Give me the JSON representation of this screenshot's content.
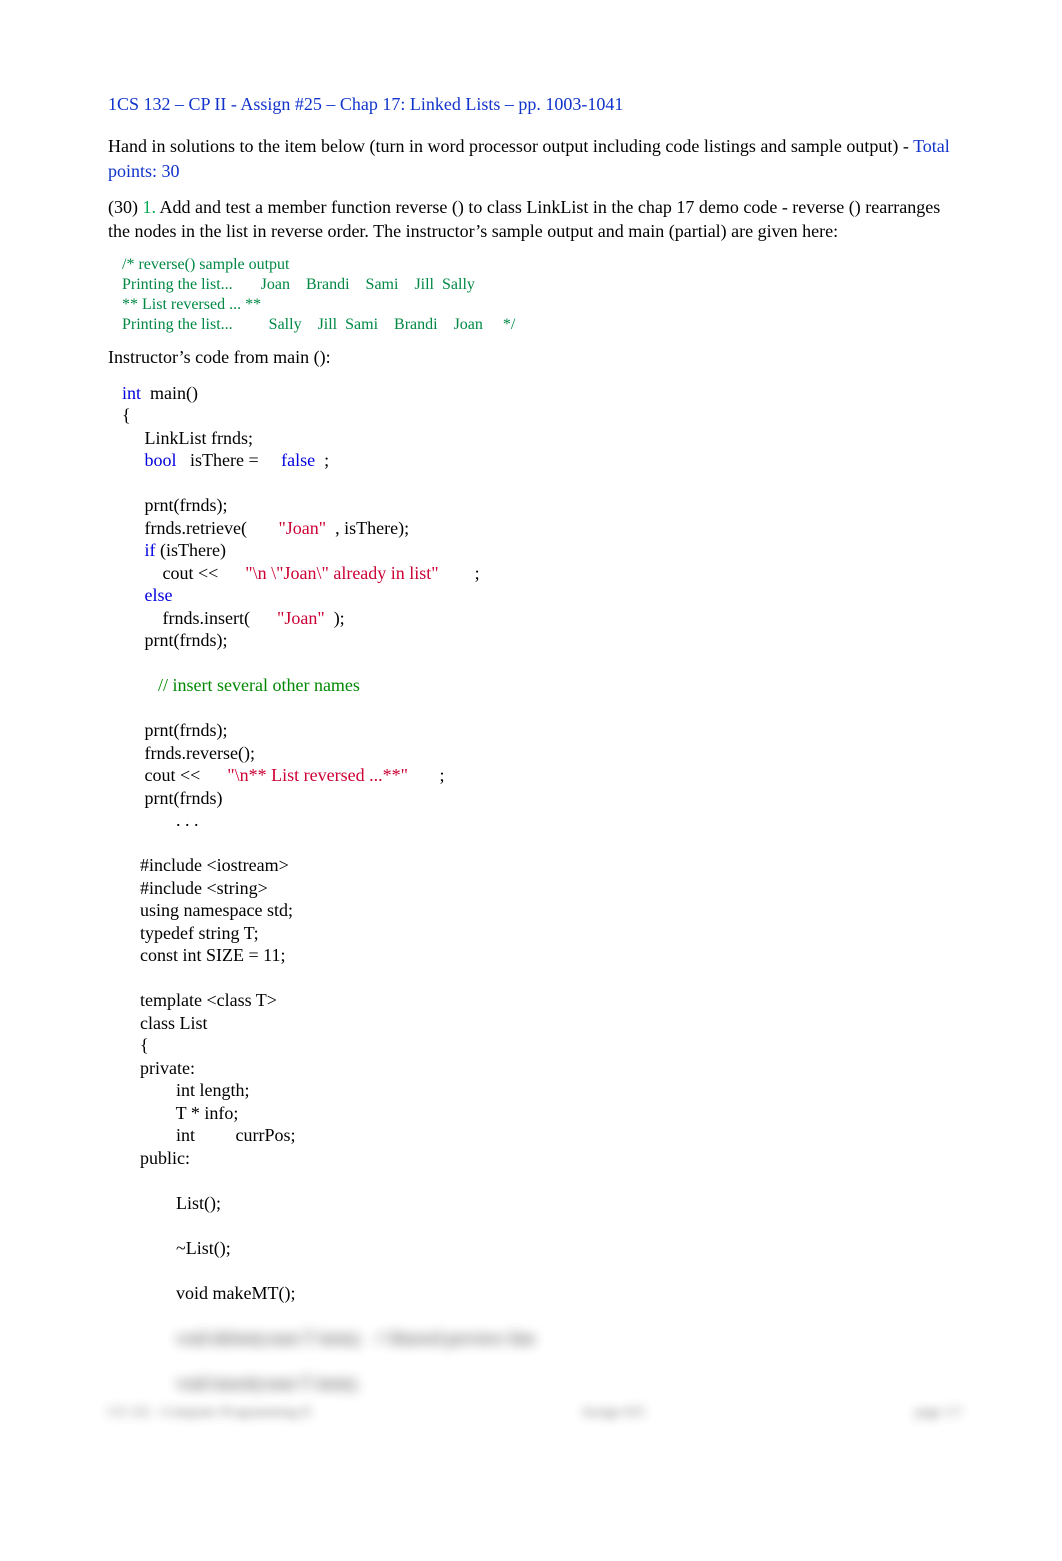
{
  "title": "1CS 132 – CP II - Assign #25 – Chap 17: Linked Lists – pp. 1003-1041",
  "intro": {
    "line1_pre": "Hand in solutions to the item below (turn in word processor output including code listings and sample output) - ",
    "points_label": "Total points:   30"
  },
  "problem": {
    "points_paren": "(30) ",
    "number": "1.",
    "text_a": "   Add and test a member function reverse   () to class LinkList in the chap 17 demo code - reverse   () rearranges the nodes in the list in reverse order. The instructor’s sample output and main (partial) are given here:"
  },
  "sample_output": {
    "l1": "/* reverse() sample output",
    "l2": "Printing the list...       Joan    Brandi    Sami    Jill  Sally",
    "l3": "** List reversed ... **",
    "l4": "Printing the list...         Sally    Jill  Sami    Brandi    Joan     */"
  },
  "instr_label": "Instructor’s code from main   ():",
  "code": {
    "l01a": "int",
    "l01b": "  main()",
    "l02": "{",
    "l03": "     LinkList frnds;",
    "l04a": "     ",
    "l04b": "bool",
    "l04c": "   isThere =     ",
    "l04d": "false",
    "l04e": "  ;",
    "l05": "",
    "l06": "     prnt(frnds);",
    "l07a": "     frnds.retrieve(       ",
    "l07b": "\"Joan\"",
    "l07c": "  , isThere);",
    "l08a": "     ",
    "l08b": "if",
    "l08c": " (isThere)",
    "l09a": "         cout <<      ",
    "l09b": "\"\\n \\\"Joan\\\" already in list\"",
    "l09c": "        ;",
    "l10a": "     ",
    "l10b": "else",
    "l11a": "         frnds.insert(      ",
    "l11b": "\"Joan\"",
    "l11c": "  );",
    "l12": "     prnt(frnds);",
    "l13": "",
    "l14": "        // insert several other names",
    "l15": "",
    "l16": "     prnt(frnds);",
    "l17": "     frnds.reverse();",
    "l18a": "     cout <<      ",
    "l18b": "\"\\n** List reversed ...**\"",
    "l18c": "       ;",
    "l19": "     prnt(frnds)",
    "l20": "            . . .",
    "l21": "",
    "l22": "    #include <iostream>",
    "l23": "    #include <string>",
    "l24": "    using namespace std;",
    "l25": "    typedef string T;",
    "l26": "    const int SIZE = 11;",
    "l27": "",
    "l28": "    template <class T>",
    "l29": "    class List",
    "l30": "    {",
    "l31": "    private:",
    "l32": "            int length;",
    "l33": "            T * info;",
    "l34": "            int         currPos;",
    "l35": "    public:",
    "l36": "",
    "l37": "            List();",
    "l38": "",
    "l39": "            ~List();",
    "l40": "",
    "l41": "            void makeMT();",
    "l42": "",
    "l43": "            void delete(const T item);   // blurred preview line",
    "l44": "",
    "l45": "            void insert(const T item);"
  },
  "footer": {
    "left": "CS 132 - Computer Programming II",
    "center": "Assign #25",
    "right": "page  1/?"
  }
}
